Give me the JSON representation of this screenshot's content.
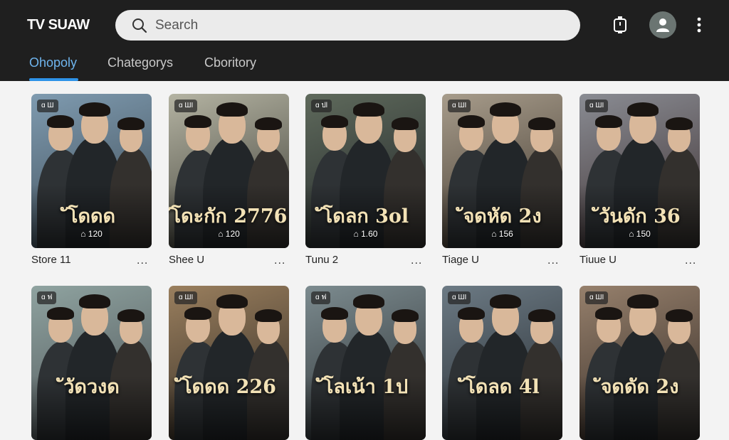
{
  "app": {
    "title": "TV SUAW"
  },
  "search": {
    "placeholder": "Search"
  },
  "tabs": [
    {
      "label": "Ohopoly",
      "active": true
    },
    {
      "label": "Chategorys",
      "active": false
    },
    {
      "label": "Cboritory",
      "active": false
    }
  ],
  "icons": {
    "search": "search-icon",
    "cast": "cast-icon",
    "profile": "person-icon",
    "more": "more-vert-icon"
  },
  "colors": {
    "accent": "#2e93e8",
    "topbar": "#1f1f1f",
    "background": "#f3f3f3"
  },
  "rows": [
    {
      "cards": [
        {
          "badge": "ɑ Ш",
          "poster_title": "ัโดดด",
          "poster_sub": "⌂ 120",
          "label": "Store 11",
          "more": "...",
          "palette": [
            "#7f9bb0",
            "#3b4852"
          ]
        },
        {
          "badge": "ɑ ШI",
          "poster_title": "ัโดะกัก 2776",
          "poster_sub": "⌂ 120",
          "label": "Shee U",
          "more": "...",
          "palette": [
            "#b4b3a2",
            "#3a3a33"
          ]
        },
        {
          "badge": "ɑ ปl",
          "poster_title": "ัโดลก 3ol",
          "poster_sub": "⌂ 1.60",
          "label": "Tunu 2",
          "more": "...",
          "palette": [
            "#5f6a5c",
            "#1f2326"
          ]
        },
        {
          "badge": "ɑ ШI",
          "poster_title": "ัจดหัด 2ง",
          "poster_sub": "⌂ 156",
          "label": "Tiage U",
          "more": "...",
          "palette": [
            "#a79c8b",
            "#3d342b"
          ]
        },
        {
          "badge": "ɑ ШI",
          "poster_title": "ัวันดัก 36",
          "poster_sub": "⌂ 150",
          "label": "Tiuue U",
          "more": "...",
          "palette": [
            "#8a8c93",
            "#3c2f30"
          ]
        }
      ]
    },
    {
      "cards": [
        {
          "badge": "ɑ ฟ",
          "poster_title": "ัวัดวงด",
          "poster_sub": "",
          "label": "",
          "more": "",
          "palette": [
            "#8fa3a0",
            "#4b5054"
          ]
        },
        {
          "badge": "ɑ ШI",
          "poster_title": "ัโดดด 226",
          "poster_sub": "",
          "label": "",
          "more": "",
          "palette": [
            "#9a7f5e",
            "#2e2822"
          ]
        },
        {
          "badge": "ɑ ฟ",
          "poster_title": "ัโลเน้า 1ป",
          "poster_sub": "",
          "label": "",
          "more": "",
          "palette": [
            "#7c8b8f",
            "#2a2e31"
          ]
        },
        {
          "badge": "ɑ ШI",
          "poster_title": "ัโดลด 4l",
          "poster_sub": "",
          "label": "",
          "more": "",
          "palette": [
            "#6c7a84",
            "#252a2f"
          ]
        },
        {
          "badge": "ɑ ШI",
          "poster_title": "ัจดดัด 2ง",
          "poster_sub": "",
          "label": "",
          "more": "",
          "palette": [
            "#96806c",
            "#332a25"
          ]
        }
      ]
    }
  ]
}
